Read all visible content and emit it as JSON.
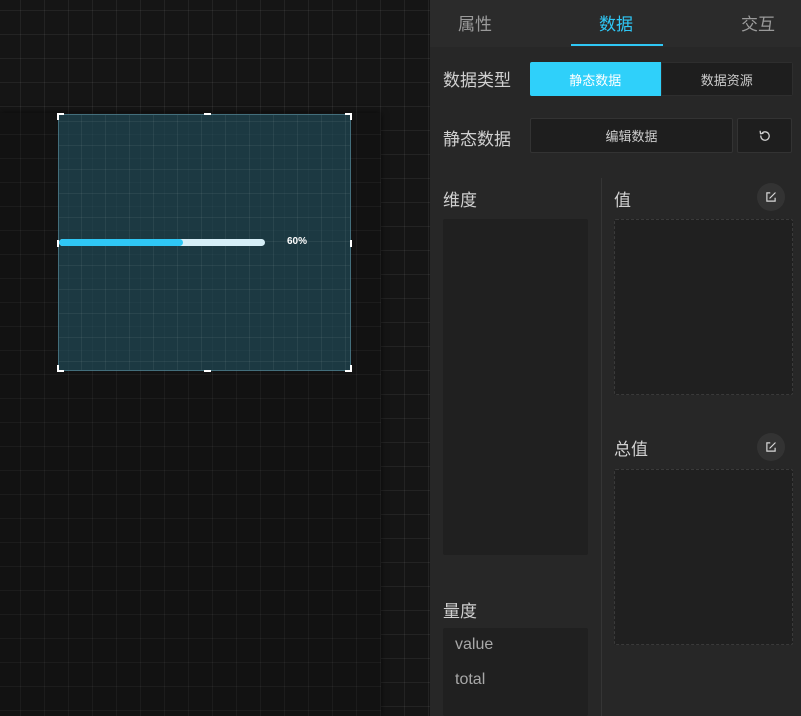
{
  "tabs": [
    {
      "label": "属性"
    },
    {
      "label": "数据"
    },
    {
      "label": "交互"
    }
  ],
  "active_tab": "数据",
  "accent_color": "#2fc7f5",
  "canvas": {
    "progress": {
      "value": 0.6,
      "label": "60%"
    }
  },
  "data_type": {
    "label": "数据类型",
    "options": [
      "静态数据",
      "数据资源"
    ],
    "selected": "静态数据"
  },
  "static_data": {
    "label": "静态数据",
    "edit_label": "编辑数据",
    "reset_icon": "refresh-icon"
  },
  "fields": {
    "dimension": {
      "label": "维度"
    },
    "value": {
      "label": "值",
      "icon": "edit-icon"
    },
    "total": {
      "label": "总值",
      "icon": "edit-icon"
    },
    "measure": {
      "label": "量度",
      "items": [
        "value",
        "total"
      ]
    }
  }
}
